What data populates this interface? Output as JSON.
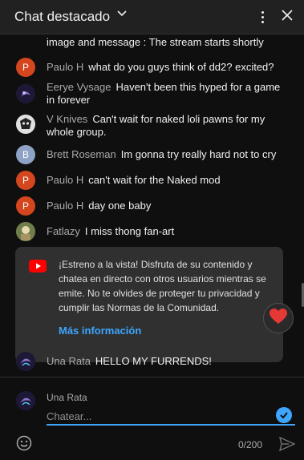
{
  "header": {
    "title": "Chat destacado"
  },
  "messages": [
    {
      "author": "",
      "text": "image and message : The stream starts shortly",
      "initial": ""
    },
    {
      "author": "Paulo H",
      "text": "what do you guys think of dd2? excited?",
      "initial": "P"
    },
    {
      "author": "Eerye Vysage",
      "text": "Haven't been this hyped for a game in forever",
      "initial": ""
    },
    {
      "author": "V Knives",
      "text": "Can't wait for naked loli pawns for my whole group.",
      "initial": ""
    },
    {
      "author": "Brett Roseman",
      "text": "Im gonna try really hard not to cry",
      "initial": "B"
    },
    {
      "author": "Paulo H",
      "text": "can't wait for the Naked mod",
      "initial": "P"
    },
    {
      "author": "Paulo H",
      "text": "day one baby",
      "initial": "P"
    },
    {
      "author": "Fatlazy",
      "text": "I miss thong fan-art",
      "initial": ""
    },
    {
      "author": "Una Rata",
      "text": "HELLO MY FURRENDS!",
      "initial": ""
    }
  ],
  "notice": {
    "text": "¡Estreno a la vista! Disfruta de su contenido y chatea en directo con otros usuarios mientras se emite. No te olvides de proteger tu privacidad y cumplir las Normas de la Comunidad.",
    "link": "Más información"
  },
  "compose": {
    "user": "Una Rata",
    "placeholder": "Chatear...",
    "counter": "0/200"
  },
  "icons": {
    "header": [
      "chevron-down-icon",
      "kebab-menu-icon",
      "close-icon"
    ],
    "notice": "youtube-icon",
    "reaction": "heart-icon",
    "compose": [
      "check-icon",
      "emoji-icon",
      "send-icon"
    ]
  },
  "colors": {
    "accent": "#3ea6ff",
    "youtube_red": "#ff0000",
    "heart": "#e53935",
    "paulo_avatar": "#d4461e",
    "brett_avatar": "#8ea2c6"
  }
}
